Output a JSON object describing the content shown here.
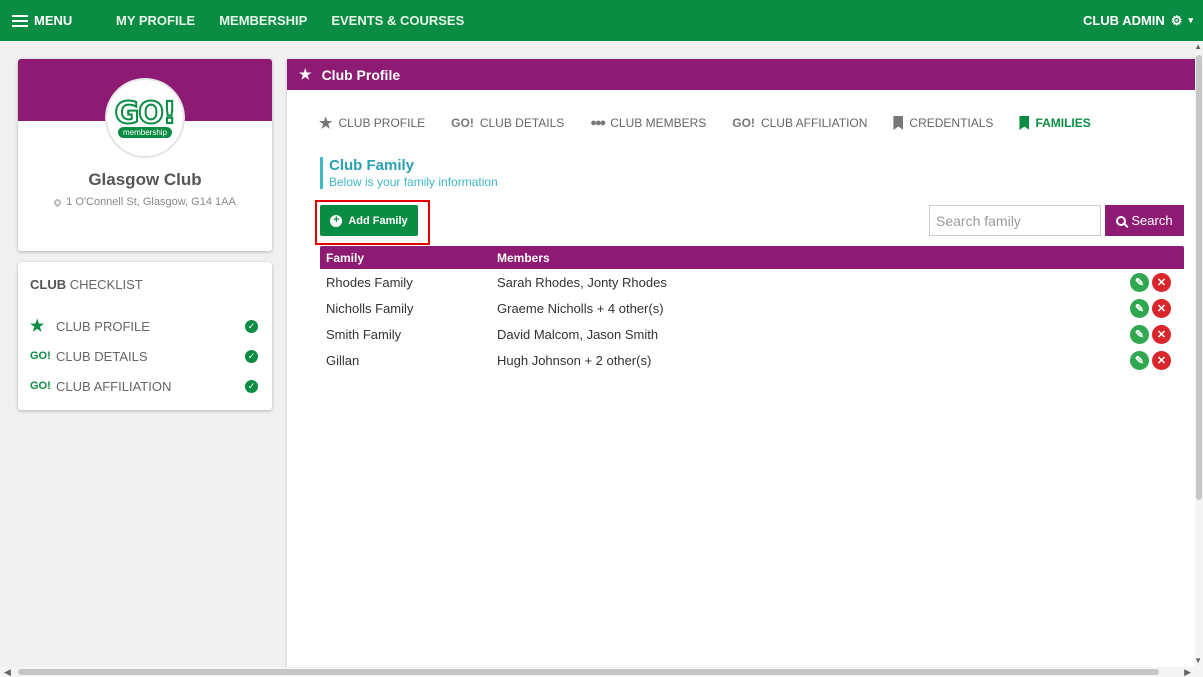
{
  "topnav": {
    "menu_label": "MENU",
    "links": [
      "MY PROFILE",
      "MEMBERSHIP",
      "EVENTS & COURSES"
    ],
    "admin_label": "CLUB ADMIN"
  },
  "profile": {
    "logo_text": "GO!",
    "logo_sub": "membership",
    "club_name": "Glasgow Club",
    "address": "1 O'Connell St, Glasgow, G14 1AA"
  },
  "checklist": {
    "title_bold": "CLUB",
    "title_rest": " CHECKLIST",
    "items": [
      {
        "icon": "star-icon",
        "icon_text": "★",
        "label": "CLUB PROFILE"
      },
      {
        "icon": "go-icon",
        "icon_text": "GO!",
        "label": "CLUB DETAILS"
      },
      {
        "icon": "go-icon",
        "icon_text": "GO!",
        "label": "CLUB AFFILIATION"
      }
    ]
  },
  "main": {
    "header_title": "Club Profile",
    "tabs": [
      {
        "label": "CLUB PROFILE",
        "icon": "star-icon",
        "icon_text": "★"
      },
      {
        "label": "CLUB DETAILS",
        "icon": "go-icon",
        "icon_text": "GO!"
      },
      {
        "label": "CLUB MEMBERS",
        "icon": "users-icon",
        "icon_text": "👥"
      },
      {
        "label": "CLUB AFFILIATION",
        "icon": "go-icon",
        "icon_text": "GO!"
      },
      {
        "label": "CREDENTIALS",
        "icon": "bookmark-icon",
        "icon_text": ""
      },
      {
        "label": "FAMILIES",
        "icon": "bookmark-icon",
        "icon_text": "",
        "active": true
      }
    ],
    "section_title": "Club Family",
    "section_subtitle": "Below is your family information",
    "add_label": "Add Family",
    "search_placeholder": "Search family",
    "search_label": "Search",
    "table": {
      "headers": [
        "Family",
        "Members"
      ],
      "rows": [
        {
          "family": "Rhodes Family",
          "members": "Sarah Rhodes, Jonty Rhodes"
        },
        {
          "family": "Nicholls Family",
          "members": "Graeme Nicholls + 4 other(s)"
        },
        {
          "family": "Smith Family",
          "members": "David Malcom, Jason Smith"
        },
        {
          "family": "Gillan",
          "members": "Hugh Johnson + 2 other(s)"
        }
      ]
    }
  },
  "colors": {
    "brand_green": "#0b8c43",
    "brand_purple": "#8e1b73",
    "accent_teal": "#3fb8c4",
    "delete_red": "#d9262b",
    "highlight_red": "#e00000"
  }
}
